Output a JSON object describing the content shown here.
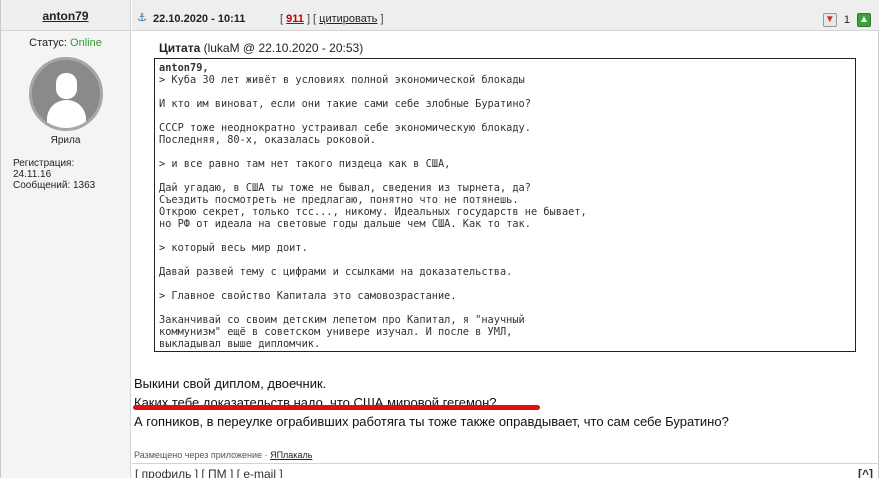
{
  "user": {
    "name": "anton79",
    "status_label": "Статус:",
    "status_value": "Online",
    "rank": "Ярила",
    "reg_label": "Регистрация:",
    "reg_date": "24.11.16",
    "messages": "Сообщений: 1363"
  },
  "header": {
    "anchor_icon": "anchor-icon",
    "date": "22.10.2020 - 10:11",
    "open_bracket": "[",
    "post_number": "911",
    "separator": "] [",
    "quote_link": "цитировать",
    "close_bracket": "]",
    "vote_score": "1"
  },
  "quote": {
    "label": "Цитата",
    "source": "(lukaM @ 22.10.2020 - 20:53)",
    "author": "anton79,",
    "text": "> Куба 30 лет живёт в условиях полной экономической блокады\n\nИ кто им виноват, если они такие сами себе злобные Буратино?\n\nСССР тоже неоднократно устраивал себе экономическую блокаду.\nПоследняя, 80-х, оказалась роковой.\n\n> и все равно там нет такого пиздеца как в США,\n\nДай угадаю, в США ты тоже не бывал, сведения из тырнета, да?\nСъездить посмотреть не предлагаю, понятно что не потянешь.\nОткрою секрет, только тсс..., никому. Идеальных государств не бывает,\nно РФ от идеала на световые годы дальше чем США. Как то так.\n\n> который весь мир доит.\n\nДавай развей тему с цифрами и ссылками на доказательства.\n\n> Главное свойство Капитала это самовозрастание.\n\nЗаканчивай со своим детским лепетом про Капитал, я \"научный\nкоммунизм\" ещё в советском универе изучал. И после в УМЛ,\nвыкладывал выше дипломчик."
  },
  "reply": {
    "line1": "Выкини свой диплом, двоечник.",
    "line2": "Каких тебе доказательств надо, что США мировой гегемон?",
    "line3": "А гопников, в переулке ограбивших работяга ты тоже также оправдывает, что сам себе Буратино?"
  },
  "footer": {
    "posted_via": "Размещено через приложение",
    "app_name": "ЯПлакаль",
    "link_profile": "профиль",
    "link_pm": "ПМ",
    "link_email": "e-mail",
    "to_top": "[^]"
  },
  "colors": {
    "online": "#2e9c2e",
    "post_number": "#c00000",
    "underline": "#e01010"
  }
}
